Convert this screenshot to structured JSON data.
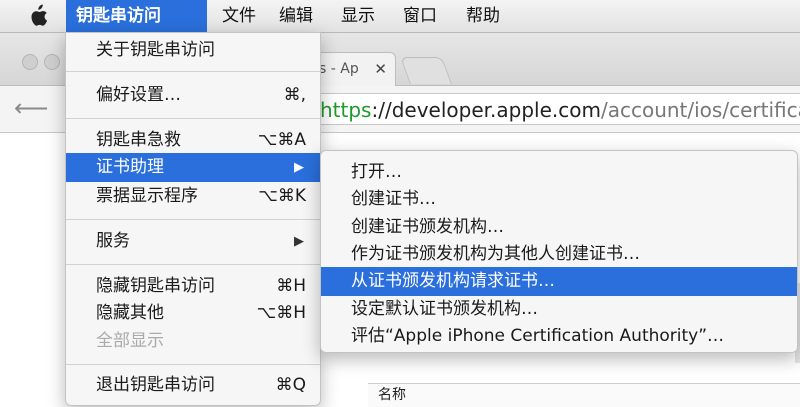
{
  "menubar": {
    "app": "钥匙串访问",
    "items": [
      "文件",
      "编辑",
      "显示",
      "窗口",
      "帮助"
    ]
  },
  "browser": {
    "tab_title": "s - Ap",
    "tab_close": "✕",
    "url_scheme": "https",
    "url_sep": "://",
    "url_host": "developer.apple.com",
    "url_path": "/account/ios/certificate/",
    "column_header": "名称"
  },
  "main_menu": {
    "about": "关于钥匙串访问",
    "prefs": "偏好设置…",
    "prefs_shortcut": "⌘,",
    "first_aid": "钥匙串急救",
    "first_aid_shortcut": "⌥⌘A",
    "cert_assistant": "证书助理",
    "ticket_viewer": "票据显示程序",
    "ticket_viewer_shortcut": "⌥⌘K",
    "services": "服务",
    "hide": "隐藏钥匙串访问",
    "hide_shortcut": "⌘H",
    "hide_others": "隐藏其他",
    "hide_others_shortcut": "⌥⌘H",
    "show_all": "全部显示",
    "quit": "退出钥匙串访问",
    "quit_shortcut": "⌘Q",
    "submenu_arrow": "▶"
  },
  "sub_menu": {
    "items": [
      "打开…",
      "创建证书…",
      "创建证书颁发机构…",
      "作为证书颁发机构为其他人创建证书…",
      "从证书颁发机构请求证书…",
      "设定默认证书颁发机构…",
      "评估“Apple iPhone Certification Authority”…"
    ]
  },
  "colors": {
    "highlight": "#2a6fdb",
    "https_green": "#1f9a2c"
  }
}
